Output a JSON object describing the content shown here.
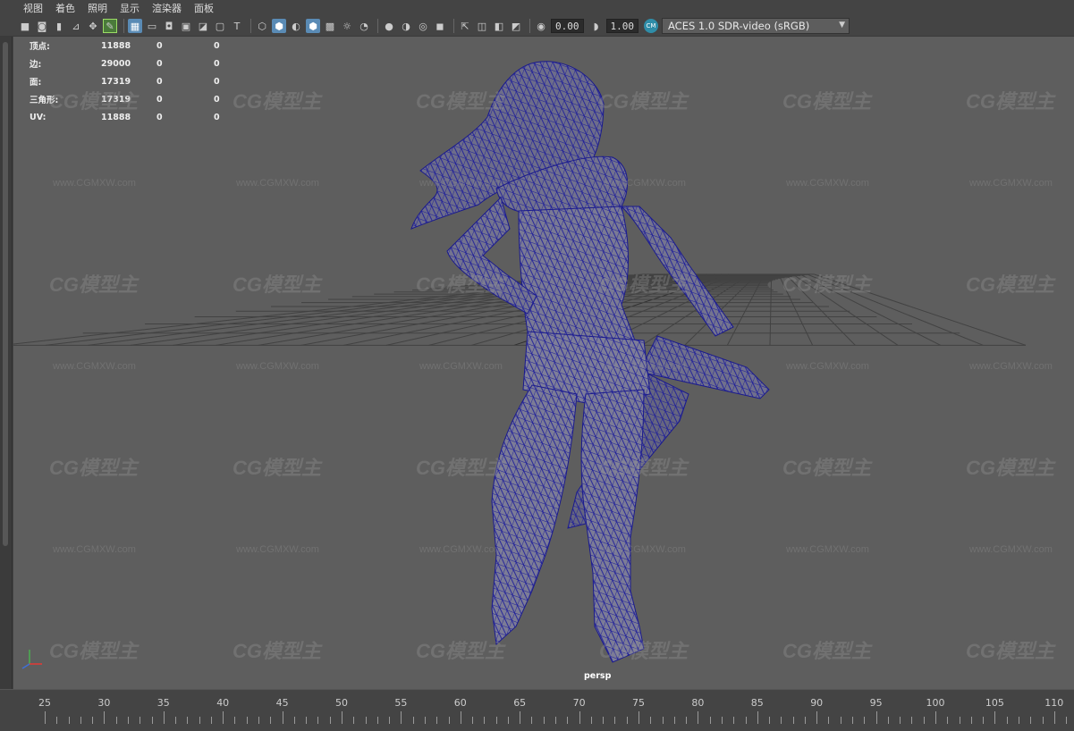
{
  "menubar": {
    "items": [
      "视图",
      "着色",
      "照明",
      "显示",
      "渲染器",
      "面板"
    ]
  },
  "toolbar": {
    "exposure_value": "0.00",
    "gamma_value": "1.00",
    "color_transform": "ACES 1.0 SDR-video (sRGB)",
    "color_badge": "CM"
  },
  "hud": {
    "rows": [
      {
        "label": "顶点:",
        "v1": "11888",
        "v2": "0",
        "v3": "0"
      },
      {
        "label": "边:",
        "v1": "29000",
        "v2": "0",
        "v3": "0"
      },
      {
        "label": "面:",
        "v1": "17319",
        "v2": "0",
        "v3": "0"
      },
      {
        "label": "三角形:",
        "v1": "17319",
        "v2": "0",
        "v3": "0"
      },
      {
        "label": "UV:",
        "v1": "11888",
        "v2": "0",
        "v3": "0"
      }
    ]
  },
  "viewport": {
    "camera_label": "persp",
    "wireframe_color": "#1a1a8c",
    "grid_color": "#3c3c3c",
    "bg_color": "#5e5e5e"
  },
  "watermark": {
    "logo_text": "CG模型主",
    "url_text": "www.CGMXW.com"
  },
  "timeline": {
    "labels": [
      "25",
      "30",
      "35",
      "40",
      "45",
      "50",
      "55",
      "60",
      "65",
      "70",
      "75",
      "80",
      "85",
      "90",
      "95",
      "100",
      "105",
      "110"
    ]
  }
}
